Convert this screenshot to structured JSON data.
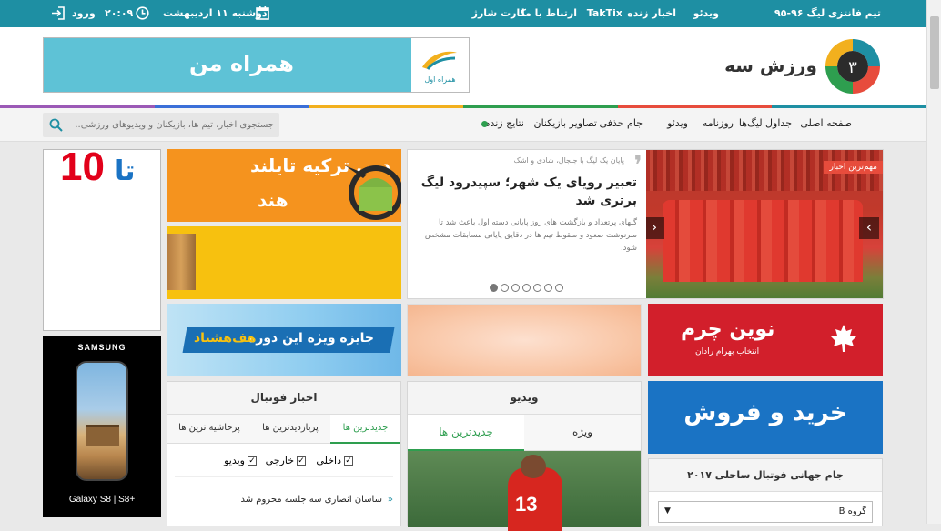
{
  "topbar": {
    "fantasy": "تیم فانتزی لیگ ۹۶-۹۵",
    "video": "ویدئو",
    "live_news": "اخبار زنده",
    "taktix": "TakTix",
    "contact": "ارتباط با ما",
    "charge": "کارت شارژ",
    "date": "دوشنبه ۱۱ اردیبهشت",
    "time": "۲۰:۰۹",
    "login": "ورود"
  },
  "brand": {
    "logo_text": "ورزش سه",
    "logo_digit": "۳",
    "ad_text": "همراه من",
    "ad_brand": "همراه اول"
  },
  "colorline": [
    "#1e8fa3",
    "#e74c3c",
    "#2e9e4f",
    "#f2b01e",
    "#3b6fd8",
    "#9b59b6"
  ],
  "nav": {
    "items": [
      "صفحه اصلی",
      "جداول لیگ‌ها",
      "روزنامه",
      "ویدئو",
      "جام حذفی",
      "تصاویر بازیکنان",
      "نتایج زنده"
    ],
    "live_color": "#2e9e4f",
    "search_placeholder": "جستجوی اخبار، تیم ها، بازیکنان و ویدیوهای ورزشی..."
  },
  "hero": {
    "badge": "مهم‌ترین اخبار",
    "kicker": "پایان یک لیگ با جنجال، شادی و اشک",
    "title": "تعبیر رویای یک شهر؛ سپیدرود لیگ برتری شد",
    "summary": "گلهای پرتعداد و بازگشت های روز پایانی دسته اول باعث شد تا سرنوشت صعود و سقوط تیم ها در دقایق پایانی مسابقات مشخص شود.",
    "dots": 7,
    "active_dot": 0
  },
  "ads": {
    "turkey": "دبی ترکیه تایلند",
    "india": "هند",
    "jayeze": "جایزه ویژه این دوره",
    "haf_hashtad": "هف‌هشتاد",
    "novin_title": "نوین چرم",
    "novin_sub": "انتخاب بهرام رادان",
    "buy_sell": "خرید و فروش",
    "ta": "تا",
    "ten": "10",
    "samsung": "SAMSUNG",
    "galaxy": "Galaxy S8 | S8+"
  },
  "football_news": {
    "title": "اخبار فوتبال",
    "tabs": [
      "جدیدترین ها",
      "پربازدیدترین ها",
      "پرحاشیه ترین ها"
    ],
    "active_tab": 0,
    "filters": [
      {
        "label": "داخلی",
        "checked": true
      },
      {
        "label": "خارجی",
        "checked": true
      },
      {
        "label": "ویدیو",
        "checked": true
      }
    ],
    "items": [
      "ساسان انصاری سه جلسه محروم شد"
    ]
  },
  "video_box": {
    "title": "ویدیو",
    "tabs": [
      "ویژه",
      "جدیدترین ها"
    ],
    "active_tab": 1,
    "jersey": "13"
  },
  "beach_cup": {
    "title": "جام جهانی فوتبال ساحلی ۲۰۱۷",
    "select_value": "گروه B"
  }
}
